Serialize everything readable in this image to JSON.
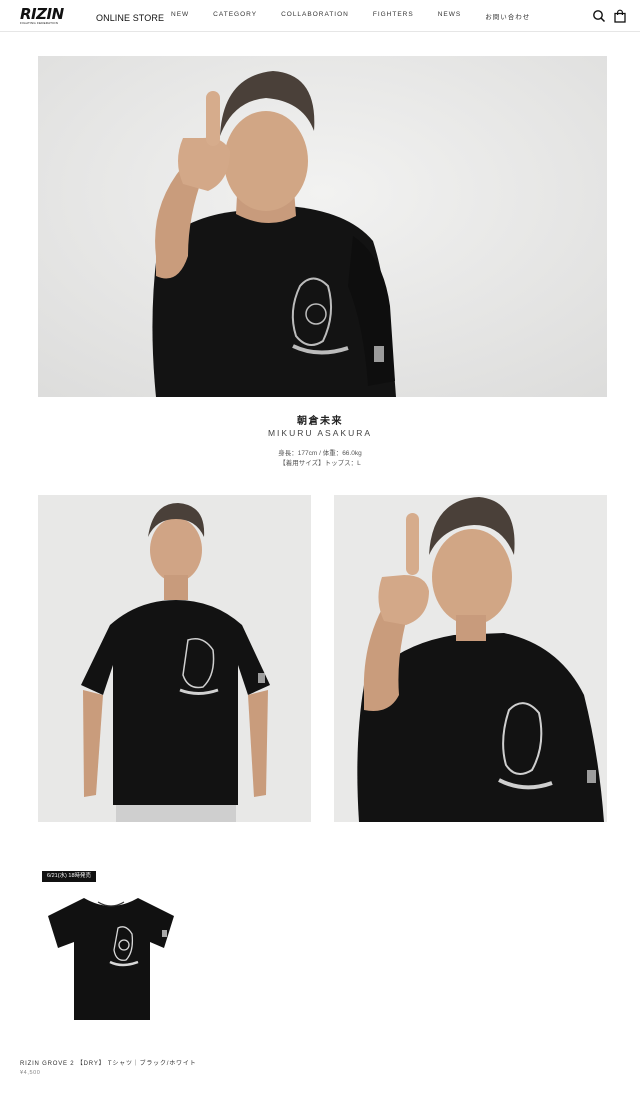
{
  "header": {
    "logo_text": "RIZIN",
    "logo_subtext": "FIGHTING FEDERATION",
    "store_label": "ONLINE STORE",
    "nav": [
      "NEW",
      "CATEGORY",
      "COLLABORATION",
      "FIGHTERS",
      "NEWS",
      "お問い合わせ"
    ],
    "icons": [
      "search-icon",
      "cart-icon"
    ]
  },
  "fighter": {
    "name_ja": "朝倉未来",
    "name_en": "MIKURU ASAKURA",
    "stats_line1": "身長：177cm / 体重：66.0kg",
    "stats_line2": "【着用サイズ】トップス：L"
  },
  "product": {
    "badge": "6/21(水) 18時発売",
    "title": "RIZIN GROVE 2 【DRY】 Tシャツ｜ブラック/ホワイト",
    "price": "¥4,500"
  },
  "colors": {
    "shirt": "#111111",
    "backdrop": "#e9e9e8",
    "text": "#1c1b1b"
  }
}
